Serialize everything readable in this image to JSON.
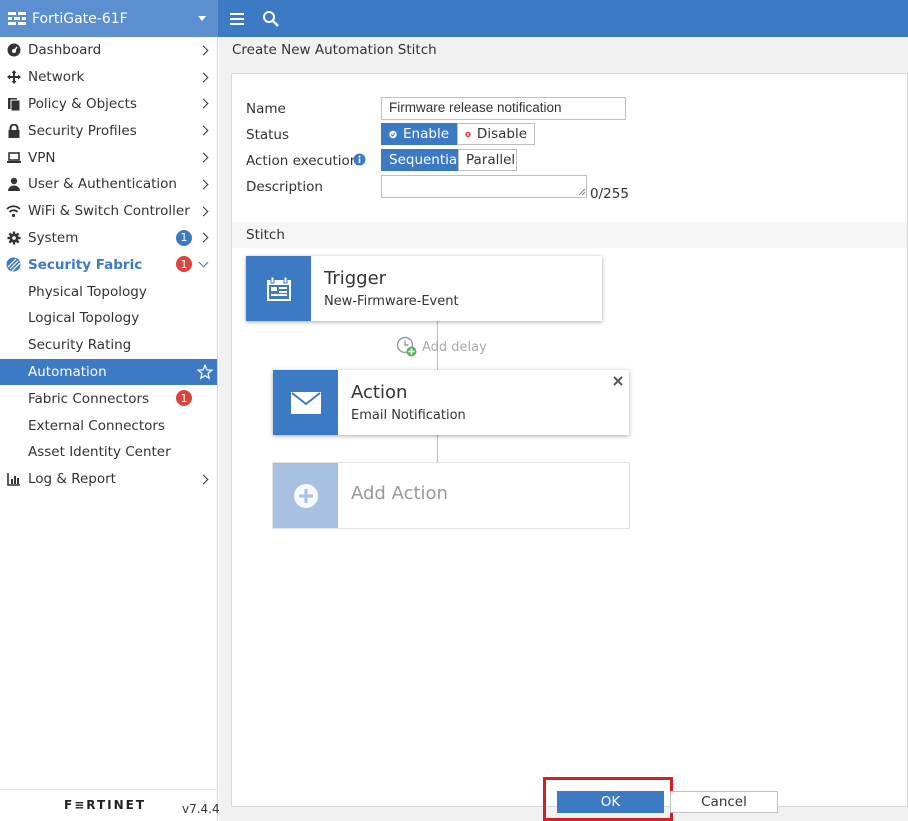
{
  "topbar": {
    "device_name": "FortiGate-61F",
    "menu_icon": "hamburger-icon",
    "search_icon": "search-icon"
  },
  "sidebar": {
    "items": [
      {
        "label": "Dashboard",
        "icon": "dashboard-icon"
      },
      {
        "label": "Network",
        "icon": "network-icon"
      },
      {
        "label": "Policy & Objects",
        "icon": "policy-icon"
      },
      {
        "label": "Security Profiles",
        "icon": "lock-icon"
      },
      {
        "label": "VPN",
        "icon": "laptop-icon"
      },
      {
        "label": "User & Authentication",
        "icon": "user-icon"
      },
      {
        "label": "WiFi & Switch Controller",
        "icon": "wifi-icon"
      },
      {
        "label": "System",
        "icon": "gear-icon",
        "badge": "1"
      },
      {
        "label": "Security Fabric",
        "icon": "fabric-icon",
        "badge": "1"
      }
    ],
    "sub_items": [
      {
        "label": "Physical Topology"
      },
      {
        "label": "Logical Topology"
      },
      {
        "label": "Security Rating"
      },
      {
        "label": "Automation"
      },
      {
        "label": "Fabric Connectors",
        "badge": "1"
      },
      {
        "label": "External Connectors"
      },
      {
        "label": "Asset Identity Center"
      }
    ],
    "log_report": {
      "label": "Log & Report",
      "icon": "chart-icon"
    },
    "logo_text": "F≡RTINET",
    "version": "v7.4.4"
  },
  "main": {
    "title": "Create New Automation Stitch",
    "form": {
      "name_label": "Name",
      "name_value": "Firmware release notification",
      "status_label": "Status",
      "status_enable": "Enable",
      "status_disable": "Disable",
      "action_exec_label": "Action execution",
      "exec_sequential": "Sequential",
      "exec_parallel": "Parallel",
      "description_label": "Description",
      "description_value": "",
      "description_counter": "0/255"
    },
    "stitch": {
      "label": "Stitch",
      "trigger_title": "Trigger",
      "trigger_sub": "New-Firmware-Event",
      "add_delay": "Add delay",
      "action_title": "Action",
      "action_sub": "Email Notification",
      "add_action": "Add Action"
    },
    "buttons": {
      "ok": "OK",
      "cancel": "Cancel"
    }
  },
  "colors": {
    "primary": "#3c7ac4",
    "badge_red": "#d9443e",
    "highlight_red": "#d42020"
  }
}
